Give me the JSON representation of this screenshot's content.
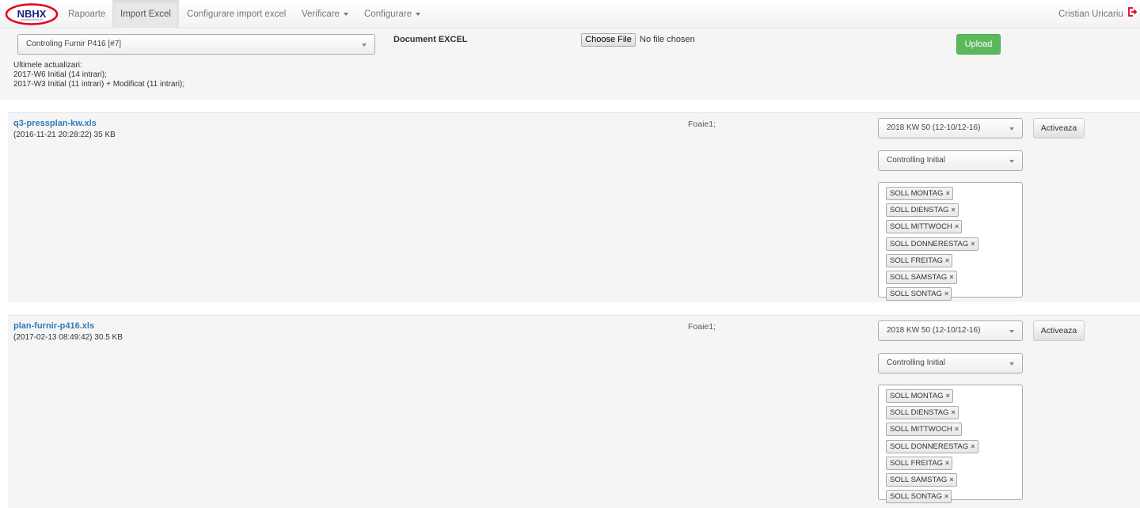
{
  "nav": {
    "logo_text": "NBHX",
    "items": [
      {
        "label": "Rapoarte"
      },
      {
        "label": "Import Excel"
      },
      {
        "label": "Configurare import excel"
      },
      {
        "label": "Verificare"
      },
      {
        "label": "Configurare"
      }
    ],
    "user": "Cristian Uricariu"
  },
  "import": {
    "config_select": "Controling Furnir P416 [#7]",
    "document_label": "Document EXCEL",
    "choose_file": "Choose File",
    "no_file": "No file chosen",
    "upload": "Upload",
    "updates_title": "Ultimele actualizari:",
    "updates": [
      "2017-W6 Initial (14 intrari);",
      "2017-W3 Initial (11 intrari) + Modificat (11 intrari);"
    ]
  },
  "files": [
    {
      "name": "q3-pressplan-kw.xls",
      "meta": "(2016-11-21 20:28:22) 35 KB",
      "sheet": "Foaie1;",
      "week": "2018 KW 50 (12-10/12-16)",
      "type": "Controlling Initial",
      "activate": "Activeaza",
      "tags": [
        "SOLL MONTAG",
        "SOLL DIENSTAG",
        "SOLL MITTWOCH",
        "SOLL DONNERESTAG",
        "SOLL FREITAG",
        "SOLL SAMSTAG",
        "SOLL SONTAG"
      ]
    },
    {
      "name": "plan-furnir-p416.xls",
      "meta": "(2017-02-13 08:49:42) 30.5 KB",
      "sheet": "Foaie1;",
      "week": "2018 KW 50 (12-10/12-16)",
      "type": "Controlling Initial",
      "activate": "Activeaza",
      "tags": [
        "SOLL MONTAG",
        "SOLL DIENSTAG",
        "SOLL MITTWOCH",
        "SOLL DONNERESTAG",
        "SOLL FREITAG",
        "SOLL SAMSTAG",
        "SOLL SONTAG"
      ]
    }
  ],
  "colors": {
    "brand_red": "#e3001b",
    "link": "#337ab7",
    "upload_green": "#5cb85c"
  },
  "icons": {
    "logout": "logout-icon",
    "remove_tag": "times-icon"
  }
}
